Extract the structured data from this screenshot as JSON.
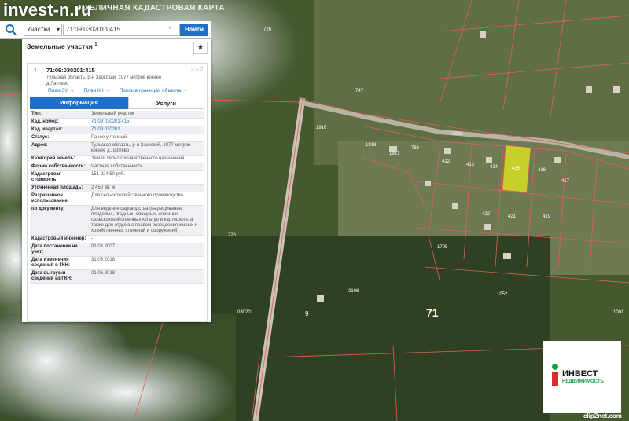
{
  "watermark": "invest-n.ru",
  "map_title": "ПУБЛИЧНАЯ КАДАСТРОВАЯ КАРТА",
  "search": {
    "category": "Участки",
    "query": "71:09:030201:0415",
    "clear": "×",
    "button": "Найти"
  },
  "panel": {
    "title": "Земельные участки",
    "count": "1",
    "star": "★",
    "item": {
      "index": "1.",
      "cad": "71:09:030201:415",
      "tools": "☆△▽",
      "address": "Тульская область, р-н Заокский, 1077 метров южнее д.Лаптево"
    },
    "links": [
      "План ЗУ →",
      "План КК →",
      "Поиск в границах объекта →"
    ],
    "tabs": [
      "Информация",
      "Услуги"
    ],
    "rows": [
      {
        "label": "Тип:",
        "value": "Земельный участок"
      },
      {
        "label": "Кад. номер:",
        "value": "71:09:030201:415"
      },
      {
        "label": "Кад. квартал:",
        "value": "71:09:030201"
      },
      {
        "label": "Статус:",
        "value": "Ранее учтенный"
      },
      {
        "label": "Адрес:",
        "value": "Тульская область, р-н Заокский, 1077 метров южнее д.Лаптево"
      },
      {
        "label": "Категория земель:",
        "value": "Земли сельскохозяйственного назначения"
      },
      {
        "label": "Форма собственности:",
        "value": "Частная собственность"
      },
      {
        "label": "Кадастровая стоимость:",
        "value": "151 924,50 руб."
      },
      {
        "label": "Уточненная площадь:",
        "value": "2 450 кв. м"
      },
      {
        "label": "Разрешенное использование:",
        "value": "Для сельскохозяйственного производства"
      },
      {
        "label": "по документу:",
        "value": "Для ведения садоводства (выращивания плодовых, ягодных, овощных, или иных сельскохозяйственных культур и картофеля, а также для отдыха с правом возведения жилых и хозяйственных строений и сооружений)"
      },
      {
        "label": "Кадастровый инженер:",
        "value": "-"
      },
      {
        "label": "Дата постановки на учет:",
        "value": "01.03.2007"
      },
      {
        "label": "Дата изменения сведений в ГКН:",
        "value": "31.05.2018"
      },
      {
        "label": "Дата выгрузки сведений из ГКН:",
        "value": "01.06.2018"
      }
    ]
  },
  "map_labels": {
    "big": "71",
    "quarter": "030201",
    "nine": "9",
    "a": "726",
    "b": "747",
    "c": "2003",
    "d": "1916",
    "e": "1918",
    "f": "1917",
    "g": "783",
    "h": "412",
    "i": "413",
    "j": "414",
    "k": "415",
    "l": "416",
    "m": "417",
    "n": "422",
    "o": "421",
    "p": "419",
    "q": "1052",
    "r": "1705",
    "s": "2106",
    "t": "1001",
    "u": "726"
  },
  "logo": {
    "line1": "ИНВЕСТ",
    "line2": "НЕДВИЖИМОСТЬ",
    "mark": "i"
  },
  "clipnet": "clip2net.com"
}
